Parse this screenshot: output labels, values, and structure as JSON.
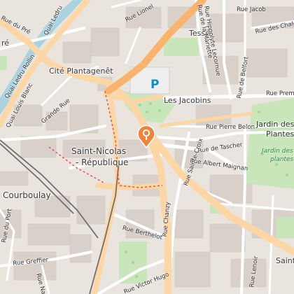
{
  "map": {
    "colors": {
      "background": "#e9e4dd",
      "building": "#d9d0c9",
      "park": "#c8e6b9",
      "river": "#aad3df",
      "main_road": "#fcd6a4",
      "primary_road": "#f9b36b",
      "minor_road": "#ffffff",
      "railway": "#707070",
      "marker": "#f0833a"
    },
    "labels": {
      "cite_plantagenet": "Cité Plantagenêt",
      "les_jacobins": "Les Jacobins",
      "tesse": "Tessé",
      "saint_nicolas": "Saint-Nicolas",
      "republique": "- République",
      "courboulay": "Courboulay",
      "jardin_des": "Jardin des",
      "plantes_place": "Plantes",
      "jardin_des_plantes_park": "Jardin des",
      "plantes_park": "plantes",
      "saint_partial": "Saint",
      "re_partial": "ré"
    },
    "streets": {
      "quai_louis_blanc": "Quai Louis Blanc",
      "quai_ledru_rollin": "Quai Ledru Rollin",
      "quai_ledru_top": "Quai Ledru",
      "grande_rue": "Grande Rue",
      "rue_lionel": "Rue Lionel",
      "rue_de_la_mariette": "Rue de la Mariette",
      "rue_hippolyte_lecornue": "Rue Hippolyte Lecornue",
      "rue_des_chalets": "Rue des Chalets",
      "rue_premartine": "Rue Prem",
      "rue_pierre_belon": "Rue Pierre Belon",
      "rue_de_tascher": "Rue de Tascher",
      "rue_albert_maignan": "Rue Albert Maignan",
      "rue_sainte_croix": "Rue Sainte-Croix",
      "rue_chanzy": "Rue Chanzy",
      "rue_berthelot": "Rue Berthelot",
      "rue_greffier": "Rue Greffier",
      "rue_victor_hugo": "Rue Victor Hugo",
      "rue_lenoir": "Rue Lenoir",
      "rue_nationale": "Rue Na",
      "rue_de_belfort": "Rue de Belfort",
      "rue_du_port": "Rue du Port",
      "rue_du_pre": "Rue du Pré",
      "rue_stai": "Rue Jacob",
      "parking_letter": "P"
    }
  }
}
